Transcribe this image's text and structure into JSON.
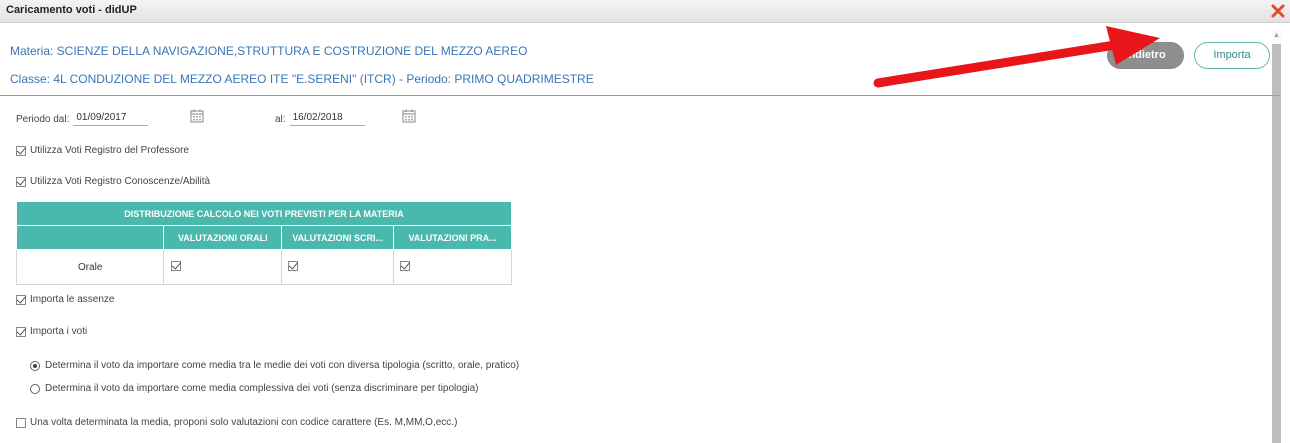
{
  "window": {
    "title": "Caricamento voti - didUP",
    "close_icon": "close-icon"
  },
  "header": {
    "materia": "Materia: SCIENZE DELLA NAVIGAZIONE,STRUTTURA E COSTRUZIONE DEL MEZZO AEREO",
    "classe": "Classe: 4L CONDUZIONE DEL MEZZO AEREO ITE \"E.SERENI\" (ITCR) - Periodo: PRIMO QUADRIMESTRE",
    "btn_indietro": "Indietro",
    "btn_importa": "Importa",
    "arrow_color": "#e8151b"
  },
  "periodo": {
    "dal_label": "Periodo dal:",
    "dal_value": "01/09/2017",
    "al_label": "al:",
    "al_value": "16/02/2018"
  },
  "options": {
    "voti_professore": "Utilizza Voti Registro del Professore",
    "voti_conoscenze": "Utilizza Voti Registro Conoscenze/Abilità",
    "assenze": "Importa le assenze",
    "voti": "Importa i voti",
    "radio_media_tipologie": "Determina il voto da importare come media tra le medie dei voti con diversa tipologia (scritto, orale, pratico)",
    "radio_media_complessiva": "Determina il voto da importare come media complessiva dei voti (senza discriminare per tipologia)",
    "solo_codice": "Una volta determinata la media, proponi solo valutazioni con codice carattere (Es. M,MM,O,ecc.)"
  },
  "table": {
    "title": "DISTRIBUZIONE CALCOLO NEI VOTI PREVISTI PER LA MATERIA",
    "columns": [
      "",
      "VALUTAZIONI ORALI",
      "VALUTAZIONI SCRI...",
      "VALUTAZIONI PRA..."
    ],
    "rows": [
      {
        "label": "Orale"
      }
    ]
  },
  "colors": {
    "accent": "#4bb8ae",
    "link_text": "#3a75b6"
  }
}
